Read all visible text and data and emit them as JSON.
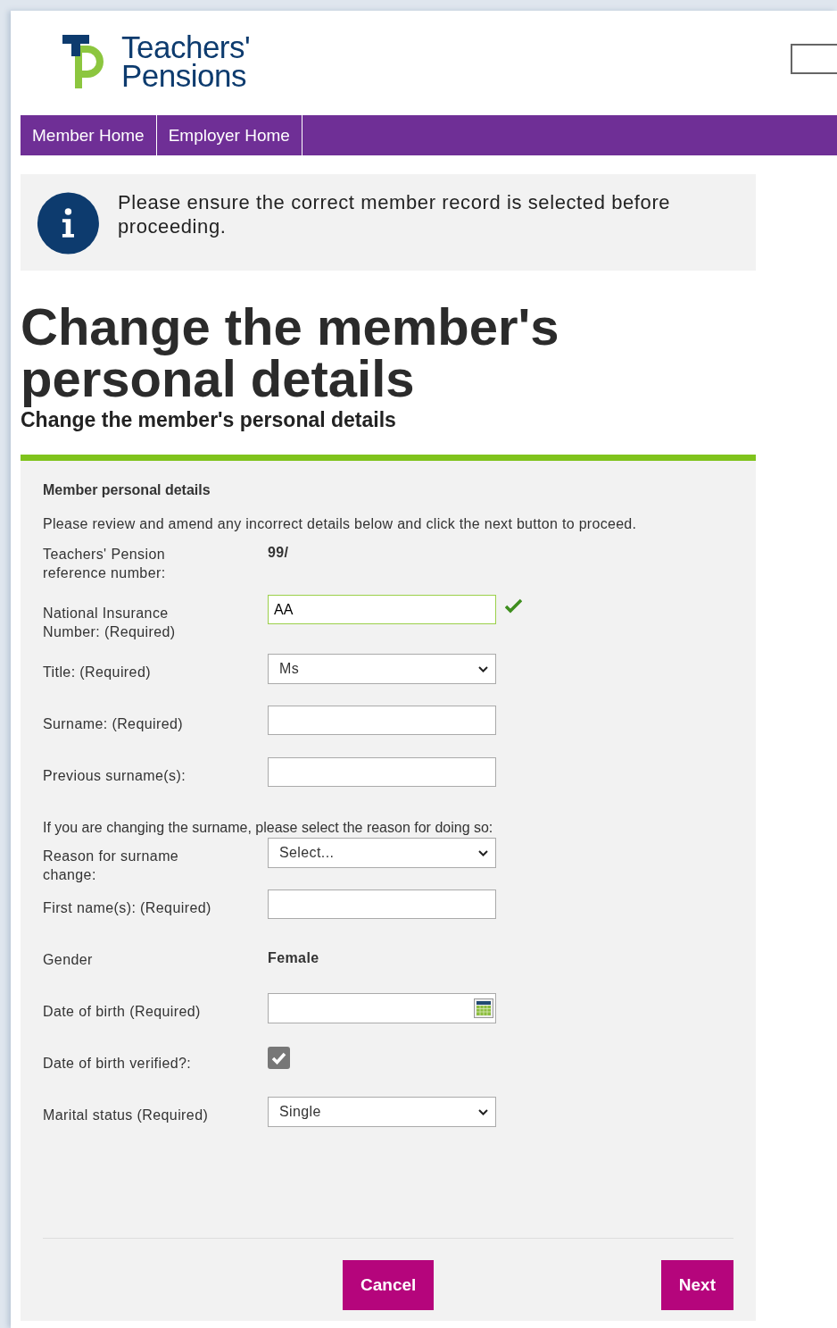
{
  "logo": {
    "line1": "Teachers'",
    "line2": "Pensions"
  },
  "nav": [
    {
      "label": "Member Home"
    },
    {
      "label": "Employer Home"
    }
  ],
  "notice": "Please ensure the correct member record is selected before proceeding.",
  "heading": "Change the member's personal details",
  "subheading": "Change the member's personal details",
  "form": {
    "section_title": "Member personal details",
    "intro": "Please review and amend any incorrect details below and click the next button to proceed.",
    "rows": [
      {
        "kind": "static",
        "label": "Teachers' Pension reference number:",
        "value": "99/"
      },
      {
        "kind": "input",
        "label": "National Insurance Number: (Required)",
        "value": "AA",
        "valid": true
      },
      {
        "kind": "select",
        "label": "Title: (Required)",
        "value": "Ms"
      },
      {
        "kind": "input",
        "label": "Surname: (Required)",
        "valid": false
      },
      {
        "kind": "input",
        "label": "Previous surname(s):",
        "valid": false
      },
      {
        "kind": "note",
        "label": "If you are changing the surname, please select the reason for doing so:"
      },
      {
        "kind": "select",
        "label": "Reason for surname change:",
        "value": "Select..."
      },
      {
        "kind": "input",
        "label": "First name(s): (Required)",
        "valid": false
      },
      {
        "kind": "static",
        "label": "Gender",
        "value": "Female"
      },
      {
        "kind": "date",
        "label": "Date of birth (Required)"
      },
      {
        "kind": "checkbox",
        "label": "Date of birth verified?:",
        "checked": true
      },
      {
        "kind": "select",
        "label": "Marital status (Required)",
        "value": "Single"
      }
    ]
  },
  "buttons": [
    {
      "label": "Cancel"
    },
    {
      "label": "Next"
    }
  ]
}
